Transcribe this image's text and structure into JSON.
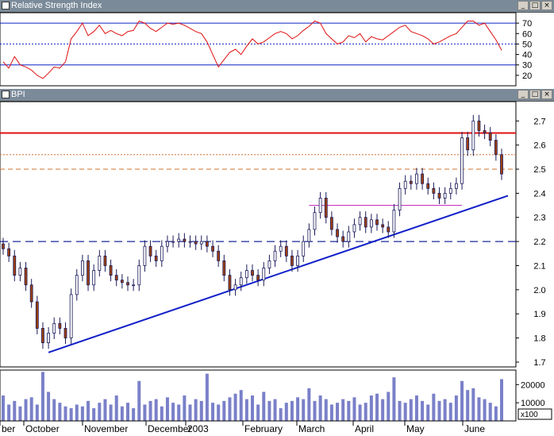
{
  "rsi_panel": {
    "title": "Relative Strength Index",
    "y_ticks": [
      "70",
      "60",
      "50",
      "40",
      "30",
      "20"
    ]
  },
  "price_panel": {
    "title": "BPI",
    "y_ticks": [
      "2.7",
      "2.6",
      "2.5",
      "2.4",
      "2.3",
      "2.2",
      "2.1",
      "2.0",
      "1.9",
      "1.8",
      "1.7"
    ]
  },
  "volume_panel": {
    "y_ticks": [
      "20000",
      "10000"
    ],
    "unit_label": "x100"
  },
  "x_axis": {
    "months": [
      "ber",
      "October",
      "November",
      "December",
      "2003",
      "February",
      "March",
      "April",
      "May",
      "June"
    ]
  },
  "window_buttons": {
    "minimize": "_",
    "maximize": "□",
    "close": "×"
  },
  "colors": {
    "rsi_line": "#e01010",
    "trend_line": "#1020c8",
    "resistance": "#e01010",
    "support_dash": "#1a2a9a",
    "volume_bar": "#7a80c8",
    "candle_down": "#a04010",
    "candle_up": "#ffffff"
  },
  "chart_data": {
    "type": "candlestick",
    "price_range": [
      1.68,
      2.78
    ],
    "rsi_range": [
      10,
      80
    ],
    "volume_max": 28000,
    "levels": {
      "resistance": 2.65,
      "dashed_support": 2.2,
      "dotted_upper": 2.56,
      "dashed_mid": 2.5,
      "channel_top": 2.35
    },
    "trendline": {
      "start": 1.74,
      "end": 2.39
    },
    "closes": [
      2.17,
      2.14,
      2.06,
      2.09,
      2.02,
      1.95,
      1.84,
      1.78,
      1.82,
      1.86,
      1.84,
      1.8,
      1.98,
      2.06,
      2.12,
      2.02,
      2.08,
      2.14,
      2.1,
      2.06,
      2.04,
      2.03,
      2.02,
      2.02,
      2.1,
      2.18,
      2.14,
      2.12,
      2.18,
      2.2,
      2.2,
      2.21,
      2.2,
      2.2,
      2.19,
      2.2,
      2.18,
      2.16,
      2.12,
      2.06,
      2.0,
      2.02,
      2.05,
      2.08,
      2.06,
      2.04,
      2.09,
      2.12,
      2.16,
      2.18,
      2.14,
      2.1,
      2.14,
      2.2,
      2.25,
      2.32,
      2.38,
      2.3,
      2.25,
      2.22,
      2.2,
      2.24,
      2.27,
      2.3,
      2.26,
      2.29,
      2.27,
      2.26,
      2.24,
      2.33,
      2.42,
      2.45,
      2.44,
      2.48,
      2.44,
      2.42,
      2.4,
      2.38,
      2.4,
      2.42,
      2.44,
      2.63,
      2.58,
      2.7,
      2.66,
      2.65,
      2.62,
      2.56,
      2.48
    ],
    "volume": [
      14000,
      9000,
      11000,
      8000,
      12000,
      13000,
      9000,
      27000,
      16000,
      12000,
      10000,
      8000,
      7000,
      9000,
      8000,
      11000,
      7000,
      10000,
      12000,
      9000,
      14000,
      8000,
      10000,
      7000,
      22000,
      9000,
      11000,
      12000,
      8000,
      13000,
      10000,
      9000,
      14000,
      9000,
      12000,
      11000,
      26000,
      10000,
      9000,
      11000,
      13000,
      15000,
      17000,
      12000,
      14000,
      9000,
      16000,
      11000,
      12000,
      7000,
      10000,
      11000,
      13000,
      12000,
      18000,
      11000,
      14000,
      12000,
      9000,
      10000,
      12000,
      11000,
      13000,
      9000,
      10000,
      14000,
      15000,
      12000,
      16000,
      24000,
      11000,
      10000,
      12000,
      14000,
      11000,
      9000,
      15000,
      11000,
      12000,
      10000,
      14000,
      22000,
      17000,
      18000,
      13000,
      12000,
      10000,
      8000,
      23000
    ],
    "rsi": [
      33,
      27,
      38,
      30,
      28,
      25,
      20,
      17,
      22,
      28,
      27,
      33,
      55,
      62,
      70,
      58,
      62,
      68,
      60,
      63,
      60,
      58,
      62,
      63,
      72,
      70,
      65,
      62,
      66,
      70,
      69,
      70,
      68,
      65,
      62,
      60,
      52,
      40,
      28,
      35,
      42,
      45,
      40,
      48,
      55,
      50,
      52,
      56,
      60,
      62,
      60,
      55,
      58,
      63,
      67,
      72,
      70,
      60,
      55,
      50,
      52,
      58,
      56,
      60,
      52,
      57,
      55,
      54,
      58,
      62,
      66,
      68,
      62,
      60,
      58,
      55,
      50,
      52,
      55,
      58,
      60,
      66,
      72,
      72,
      68,
      70,
      62,
      54,
      44
    ]
  }
}
